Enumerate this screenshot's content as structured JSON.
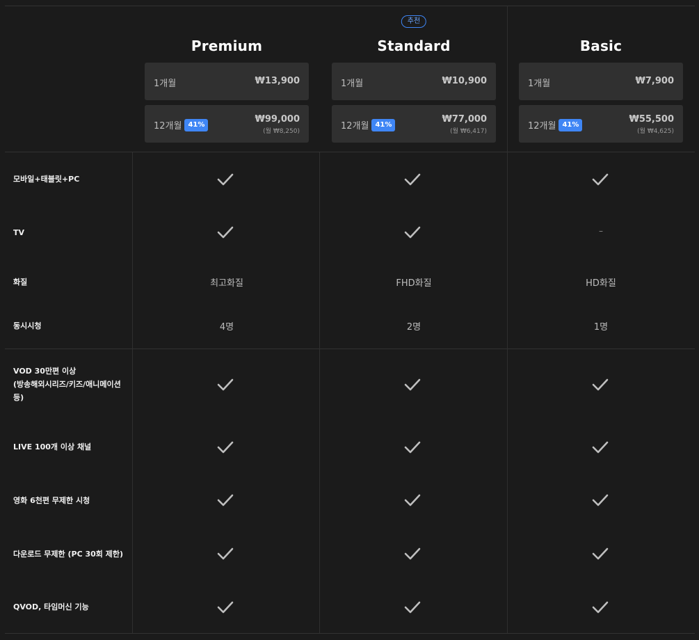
{
  "plans": [
    {
      "name": "Premium",
      "recommended_label": "",
      "monthly": {
        "period": "1개월",
        "price": "₩13,900"
      },
      "yearly": {
        "period": "12개월",
        "discount": "41%",
        "price": "₩99,000",
        "per_month": "(월 ₩8,250)"
      }
    },
    {
      "name": "Standard",
      "recommended_label": "추천",
      "monthly": {
        "period": "1개월",
        "price": "₩10,900"
      },
      "yearly": {
        "period": "12개월",
        "discount": "41%",
        "price": "₩77,000",
        "per_month": "(월 ₩6,417)"
      }
    },
    {
      "name": "Basic",
      "recommended_label": "",
      "monthly": {
        "period": "1개월",
        "price": "₩7,900"
      },
      "yearly": {
        "period": "12개월",
        "discount": "41%",
        "price": "₩55,500",
        "per_month": "(월 ₩4,625)"
      }
    }
  ],
  "features": {
    "device": {
      "label": "모바일+태블릿+PC",
      "values": [
        "check",
        "check",
        "check"
      ]
    },
    "tv": {
      "label": "TV",
      "values": [
        "check",
        "check",
        "–"
      ]
    },
    "quality": {
      "label": "화질",
      "values": [
        "최고화질",
        "FHD화질",
        "HD화질"
      ]
    },
    "concurrent": {
      "label": "동시시청",
      "values": [
        "4명",
        "2명",
        "1명"
      ]
    },
    "vod": {
      "label_line1": "VOD 30만편 이상",
      "label_line2": "(방송해외시리즈/키즈/애니메이션",
      "label_line3": "등)",
      "values": [
        "check",
        "check",
        "check"
      ]
    },
    "live": {
      "label": "LIVE 100개 이상 채널",
      "values": [
        "check",
        "check",
        "check"
      ]
    },
    "movies": {
      "label": "영화 6천편 무제한 시청",
      "values": [
        "check",
        "check",
        "check"
      ]
    },
    "download": {
      "label": "다운로드 무제한 (PC 30회 제한)",
      "values": [
        "check",
        "check",
        "check"
      ]
    },
    "qvod": {
      "label": "QVOD, 타임머신 기능",
      "values": [
        "check",
        "check",
        "check"
      ]
    }
  },
  "icons": {
    "check": "check-icon",
    "dash": "dash"
  },
  "colors": {
    "accent": "#3f86f5",
    "background": "#1b1b1b",
    "price_box": "#303030"
  }
}
